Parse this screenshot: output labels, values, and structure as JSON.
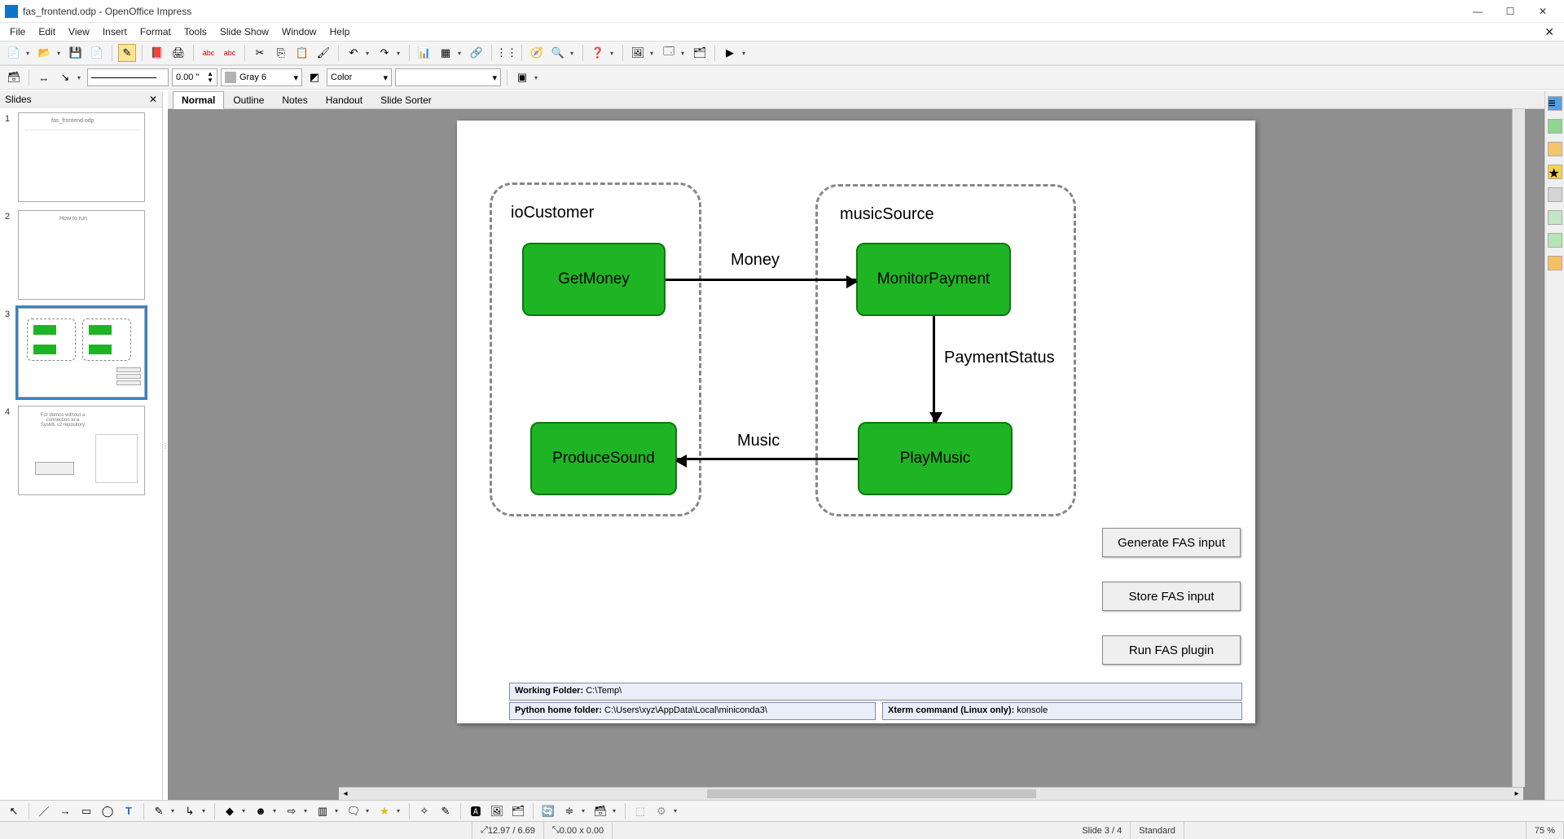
{
  "window": {
    "title": "fas_frontend.odp - OpenOffice Impress"
  },
  "menu": {
    "items": [
      "File",
      "Edit",
      "View",
      "Insert",
      "Format",
      "Tools",
      "Slide Show",
      "Window",
      "Help"
    ]
  },
  "toolbar2": {
    "line_width": "0.00 \"",
    "line_color_name": "Gray 6",
    "line_color_hex": "#b2b2b2",
    "fill_mode": "Color",
    "fill_value": ""
  },
  "slides_panel": {
    "title": "Slides",
    "items": [
      {
        "num": "1",
        "title": "fas_frontend.odp"
      },
      {
        "num": "2",
        "title": "How to run"
      },
      {
        "num": "3",
        "title": ""
      },
      {
        "num": "4",
        "title": "For demos without a connection to a SysML v2 repository"
      }
    ],
    "selected_index": 2
  },
  "view_tabs": {
    "items": [
      "Normal",
      "Outline",
      "Notes",
      "Handout",
      "Slide Sorter"
    ],
    "active_index": 0
  },
  "diagram": {
    "groups": {
      "left": {
        "label": "ioCustomer"
      },
      "right": {
        "label": "musicSource"
      }
    },
    "nodes": {
      "get_money": {
        "label": "GetMoney"
      },
      "monitor_payment": {
        "label": "MonitorPayment"
      },
      "produce_sound": {
        "label": "ProduceSound"
      },
      "play_music": {
        "label": "PlayMusic"
      }
    },
    "edges": {
      "money": {
        "label": "Money"
      },
      "payment_status": {
        "label": "PaymentStatus"
      },
      "music": {
        "label": "Music"
      }
    },
    "buttons": {
      "generate": "Generate FAS input",
      "store": "Store FAS input",
      "run": "Run FAS plugin"
    },
    "info": {
      "working_folder_label": "Working Folder:",
      "working_folder_value": "C:\\Temp\\",
      "python_home_label": "Python home folder:",
      "python_home_value": "C:\\Users\\xyz\\AppData\\Local\\miniconda3\\",
      "xterm_label": "Xterm command (Linux only):",
      "xterm_value": "konsole"
    }
  },
  "statusbar": {
    "coords": "12.97 / 6.69",
    "size": "0.00 x 0.00",
    "slide": "Slide 3 / 4",
    "layout": "Standard",
    "zoom": "75 %"
  }
}
